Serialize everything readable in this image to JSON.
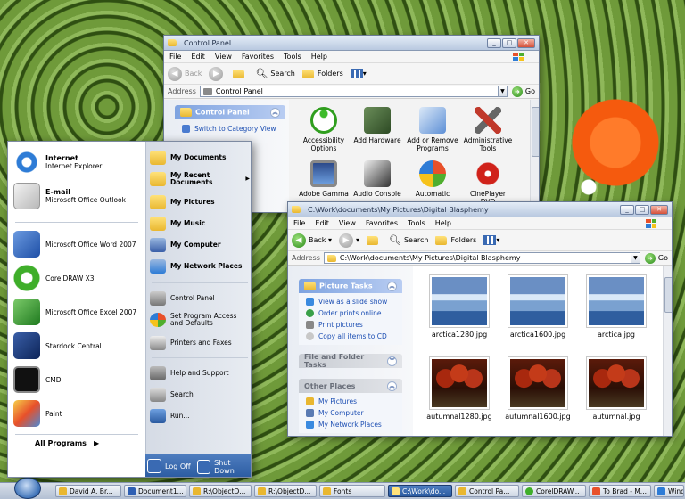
{
  "colors": {
    "accent": "#2a5aa0",
    "link": "#1d4fb3",
    "folder": "#e9b730"
  },
  "control_panel": {
    "title": "Control Panel",
    "menu": [
      "File",
      "Edit",
      "View",
      "Favorites",
      "Tools",
      "Help"
    ],
    "toolbar": {
      "back": "Back",
      "search": "Search",
      "folders": "Folders"
    },
    "address_label": "Address",
    "address_value": "Control Panel",
    "go": "Go",
    "side_header": "Control Panel",
    "side_link": "Switch to Category View",
    "icons": [
      {
        "label": "Accessibility Options",
        "icon": "accessibility-icon"
      },
      {
        "label": "Add Hardware",
        "icon": "hardware-icon"
      },
      {
        "label": "Add or Remove Programs",
        "icon": "programs-icon"
      },
      {
        "label": "Administrative Tools",
        "icon": "tools-icon"
      },
      {
        "label": "Adobe Gamma",
        "icon": "monitor-icon"
      },
      {
        "label": "Audio Console",
        "icon": "audio-icon"
      },
      {
        "label": "Automatic",
        "icon": "windows-update-icon"
      },
      {
        "label": "CinePlayer DVD",
        "icon": "dvd-icon"
      }
    ]
  },
  "explorer": {
    "title": "C:\\Work\\documents\\My Pictures\\Digital Blasphemy",
    "menu": [
      "File",
      "Edit",
      "View",
      "Favorites",
      "Tools",
      "Help"
    ],
    "toolbar": {
      "back": "Back",
      "search": "Search",
      "folders": "Folders"
    },
    "address_label": "Address",
    "address_value": "C:\\Work\\documents\\My Pictures\\Digital Blasphemy",
    "go": "Go",
    "picture_tasks": {
      "header": "Picture Tasks",
      "links": [
        "View as a slide show",
        "Order prints online",
        "Print pictures",
        "Copy all items to CD"
      ]
    },
    "file_folder_tasks": "File and Folder Tasks",
    "other_places": {
      "header": "Other Places",
      "links": [
        "My Pictures",
        "My Computer",
        "My Network Places"
      ]
    },
    "files": [
      {
        "name": "arctica1280.jpg",
        "kind": "arctic"
      },
      {
        "name": "arctica1600.jpg",
        "kind": "arctic"
      },
      {
        "name": "arctica.jpg",
        "kind": "arctic"
      },
      {
        "name": "autumnal1280.jpg",
        "kind": "autumn"
      },
      {
        "name": "autumnal1600.jpg",
        "kind": "autumn"
      },
      {
        "name": "autumnal.jpg",
        "kind": "autumn"
      }
    ]
  },
  "start_menu": {
    "pinned": [
      {
        "title": "Internet",
        "subtitle": "Internet Explorer",
        "icon": "internet-explorer-icon"
      },
      {
        "title": "E-mail",
        "subtitle": "Microsoft Office Outlook",
        "icon": "outlook-icon"
      }
    ],
    "recent": [
      {
        "label": "Microsoft Office Word 2007",
        "icon": "word-icon"
      },
      {
        "label": "CorelDRAW X3",
        "icon": "coreldraw-icon"
      },
      {
        "label": "Microsoft Office Excel 2007",
        "icon": "excel-icon"
      },
      {
        "label": "Stardock Central",
        "icon": "stardock-icon"
      },
      {
        "label": "CMD",
        "icon": "cmd-icon"
      },
      {
        "label": "Paint",
        "icon": "paint-icon"
      }
    ],
    "all_programs": "All Programs",
    "right": [
      {
        "label": "My Documents",
        "icon": "documents-icon"
      },
      {
        "label": "My Recent Documents",
        "icon": "recent-documents-icon"
      },
      {
        "label": "My Pictures",
        "icon": "pictures-icon"
      },
      {
        "label": "My Music",
        "icon": "music-icon"
      },
      {
        "label": "My Computer",
        "icon": "computer-icon"
      },
      {
        "label": "My Network Places",
        "icon": "network-icon"
      },
      {
        "label": "Control Panel",
        "icon": "control-panel-icon"
      },
      {
        "label": "Set Program Access and Defaults",
        "icon": "program-access-icon"
      },
      {
        "label": "Printers and Faxes",
        "icon": "printer-icon"
      },
      {
        "label": "Help and Support",
        "icon": "help-icon"
      },
      {
        "label": "Search",
        "icon": "search-icon"
      },
      {
        "label": "Run...",
        "icon": "run-icon"
      }
    ],
    "log_off": "Log Off",
    "shut_down": "Shut Down"
  },
  "taskbar": {
    "items": [
      {
        "label": "David A. Br...",
        "active": false
      },
      {
        "label": "Document1...",
        "active": false
      },
      {
        "label": "R:\\ObjectD...",
        "active": false
      },
      {
        "label": "R:\\ObjectD...",
        "active": false
      },
      {
        "label": "Fonts",
        "active": false
      },
      {
        "label": "C:\\Work\\do...",
        "active": true
      },
      {
        "label": "Control Pa...",
        "active": false
      },
      {
        "label": "CorelDRAW...",
        "active": false
      },
      {
        "label": "To Brad - M...",
        "active": false
      },
      {
        "label": "Wind...",
        "active": false
      }
    ]
  }
}
